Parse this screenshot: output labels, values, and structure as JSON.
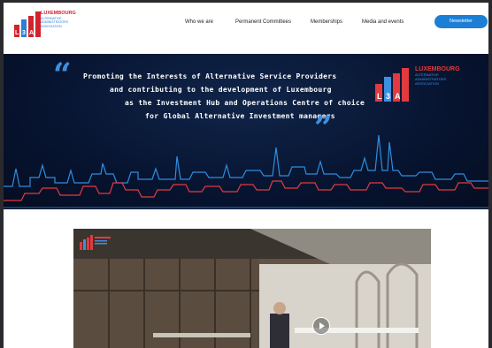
{
  "header": {
    "logo_mark": "L3A",
    "logo_title": "LUXEMBOURG",
    "logo_sub1": "ALTERNATIVE",
    "logo_sub2": "ADMINISTRATORS",
    "logo_sub3": "ASSOCIATION",
    "nav": [
      "Who we are",
      "Permanent Committees",
      "Memberships",
      "Media and events"
    ],
    "cta_label": "Newsletter"
  },
  "banner": {
    "lines": [
      "Promoting the Interests of Alternative Service Providers",
      "and contributing to the development of Luxembourg",
      "as the Investment Hub and Operations Centre of choice",
      "for Global Alternative Investment managers"
    ],
    "open_quote": "“",
    "close_quote": "”",
    "logo_mark": "L3A",
    "logo_title": "LUXEMBOURG",
    "logo_sub1": "ALTERNATIVE",
    "logo_sub2": "ADMINISTRATORS",
    "logo_sub3": "ASSOCIATION"
  },
  "video": {
    "play_icon": "play-icon"
  },
  "colors": {
    "brand_red": "#d0232c",
    "brand_blue": "#1c7fd6",
    "banner_bg": "#071430"
  }
}
